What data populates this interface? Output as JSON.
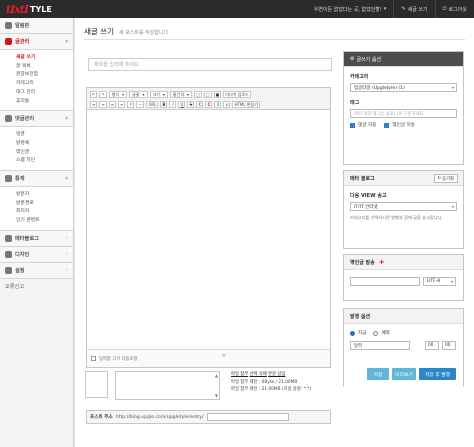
{
  "topbar": {
    "logo_mark": "tIxtI",
    "logo_word": "TYLE",
    "nav": [
      {
        "label": "우연이든 없었다는 곳, 없었던할!",
        "icon": "chevron-down-icon"
      },
      {
        "label": "새글 쓰기",
        "icon": "pencil-icon"
      },
      {
        "label": "로그아웃",
        "icon": "power-icon"
      }
    ]
  },
  "sidebar": {
    "sections": [
      {
        "label": "알림판",
        "icon": "home-icon",
        "active": false
      },
      {
        "label": "글관리",
        "icon": "document-icon",
        "active": true,
        "items": [
          "새글 쓰기",
          "글 목록",
          "글감보관함",
          "카테고리",
          "태그 관리",
          "휴지통"
        ],
        "current": 0
      },
      {
        "label": "댓글관리",
        "icon": "comment-icon",
        "active": false,
        "items": [
          "댓글",
          "방명록",
          "엮인글",
          "스팸 차단"
        ]
      },
      {
        "label": "통계",
        "icon": "chart-icon",
        "active": false,
        "items": [
          "방문자",
          "방문경로",
          "최지자",
          "인기 콘텐트"
        ]
      },
      {
        "label": "메타블로그",
        "icon": "meta-icon",
        "active": false
      },
      {
        "label": "디자인",
        "icon": "palette-icon",
        "active": false
      },
      {
        "label": "설정",
        "icon": "gear-icon",
        "active": false
      }
    ],
    "bottom_link": "오류신고"
  },
  "page": {
    "title": "새글 쓰기",
    "subtitle": "새 포스트를 작성합니다"
  },
  "editor": {
    "title_placeholder": "제목을 입력해 주세요",
    "toolbar_row1": [
      "↶",
      "↷"
    ],
    "toolbar_selects": [
      "형식",
      "글꼴",
      "크기",
      "줄간격"
    ],
    "toolbar_misc": [
      "□",
      "□",
      "■",
      "미디어 업로드"
    ],
    "toolbar_row2": [
      "B",
      "I",
      "U",
      "S",
      "C",
      "C",
      "X",
      "x"
    ],
    "toolbar_row2b": [
      "≡",
      "≡",
      "≡",
      "≡",
      "❝",
      "—",
      "URL",
      "HTML 편집기"
    ],
    "autosize_label": "입력창 크기 자동조절"
  },
  "attach": {
    "up_arrow": "▲",
    "down_arrow": "▼",
    "line1_a": "파일 첨부",
    "line1_b": "선택 삭제",
    "line1_c": "본문 삽입",
    "line2": "파일 첨부 제한 : 0Byte / 21.00MB",
    "line3": "파일 첨부 제한 : 21.00MB (허용 용량: *.*)"
  },
  "post_address": {
    "label": "포스트 주소",
    "prefix": "http://blog.upgle.com/upgletyle/entry/"
  },
  "right": {
    "options_header": "글쓰기 옵션",
    "category_label": "카테고리",
    "category_value": "업글타일 (Upgletyle) (1)",
    "tag_label": "태그",
    "tag_placeholder": "여러 개의 태그는 쉼표(,)로 구분하세요",
    "comment_allow": "댓글 허용",
    "trackback_allow": "엮인글 허용",
    "meta_header": "메타 블로그",
    "sync_button": "동기화",
    "daum_label": "다음 VIEW 송고",
    "daum_value": "IT/IT 인터넷",
    "daum_note": "카테고리를 선택하시면 발행과 함께 글을 송고합니다.",
    "trackback_header": "엮인글 발송",
    "encoding_value": "UTF-8",
    "publish_header": "발행 옵션",
    "now_label": "지금",
    "reserve_label": "예약",
    "calendar_label": "달력",
    "hour_value": "00",
    "min_value": "00"
  },
  "buttons": {
    "save": "저장",
    "preview": "미리보기",
    "save_publish": "저장 후 발행"
  }
}
